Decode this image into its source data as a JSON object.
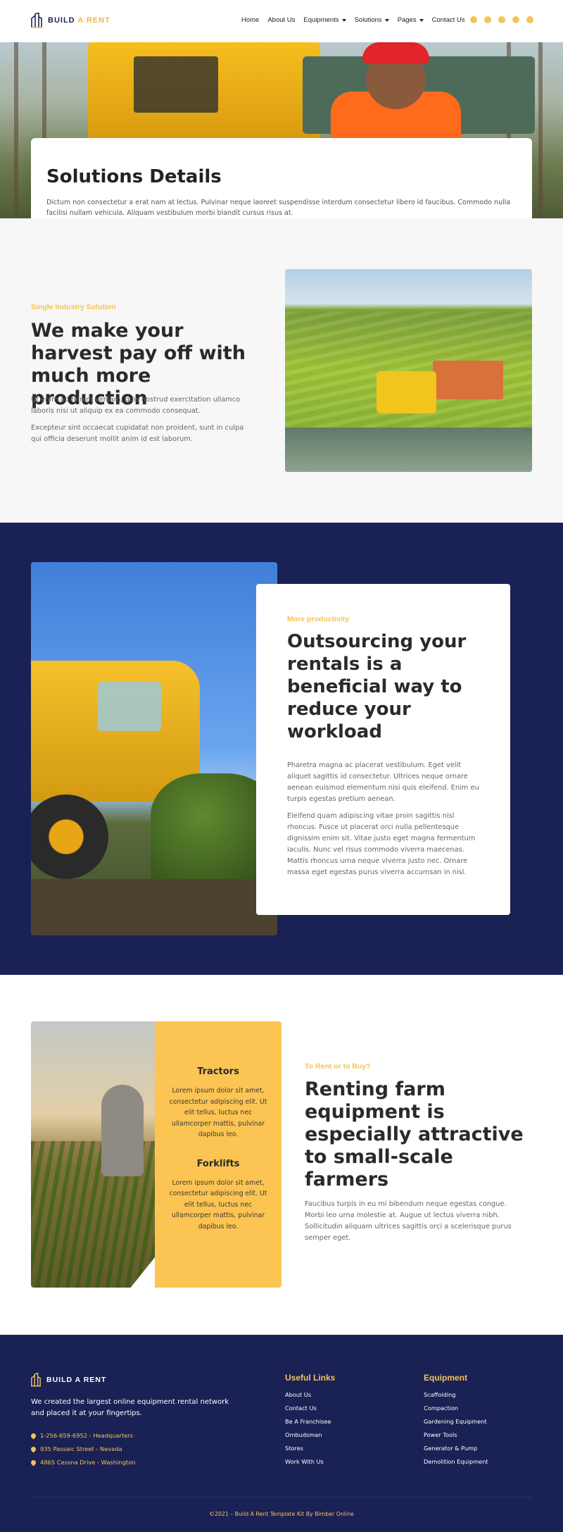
{
  "header": {
    "logo_part1": "BUILD",
    "logo_part2": "A RENT",
    "nav": [
      "Home",
      "About Us",
      "Equipments",
      "Solutions",
      "Pages",
      "Contact Us"
    ],
    "social_icons": [
      "instagram-icon",
      "facebook-icon",
      "twitter-icon",
      "youtube-icon",
      "dribbble-icon"
    ]
  },
  "hero": {
    "title": "Solutions Details",
    "text": "Dictum non consectetur a erat nam at lectus. Pulvinar neque laoreet suspendisse interdum consectetur libero id faucibus. Commodo nulla facilisi nullam vehicula. Aliquam vestibulum morbi blandit cursus risus at."
  },
  "section1": {
    "eyebrow": "Single Industry Solution",
    "heading": "We make your harvest pay off with much more production",
    "p1": "Ut enim ad minim veniam, quis nostrud exercitation ullamco laboris nisi ut aliquip ex ea commodo consequat.",
    "p2": "Excepteur sint occaecat cupidatat non proident, sunt in culpa qui officia deserunt mollit anim id est laborum."
  },
  "section2": {
    "eyebrow": "More productivity",
    "heading": "Outsourcing your rentals is a beneficial way to reduce your workload",
    "p1": "Pharetra magna ac placerat vestibulum. Eget velit aliquet sagittis id consectetur. Ultrices neque ornare aenean euismod elementum nisi quis eleifend. Enim eu turpis egestas pretium aenean.",
    "p2": "Eleifend quam adipiscing vitae proin sagittis nisl rhoncus. Fusce ut placerat orci nulla pellentesque dignissim enim sit. Vitae justo eget magna fermentum iaculis. Nunc vel risus commodo viverra maecenas. Mattis rhoncus urna neque viverra justo nec. Ornare massa eget egestas purus viverra accumsan in nisl."
  },
  "section3": {
    "card_title1": "Tractors",
    "card_text1": "Lorem ipsum dolor sit amet, consectetur adipiscing elit. Ut elit tellus, luctus nec ullamcorper mattis, pulvinar dapibus leo.",
    "card_title2": "Forklifts",
    "card_text2": "Lorem ipsum dolor sit amet, consectetur adipiscing elit. Ut elit tellus, luctus nec ullamcorper mattis, pulvinar dapibus leo.",
    "eyebrow": "To Rent or to Buy?",
    "heading": "Renting farm equipment is especially attractive to small-scale farmers",
    "p1": "Faucibus turpis in eu mi bibendum neque egestas congue. Morbi leo urna molestie at. Augue ut lectus viverra nibh. Sollicitudin aliquam ultrices sagittis orci a scelerisque purus semper eget."
  },
  "footer": {
    "logo": "BUILD A RENT",
    "description": "We created the largest online equipment rental network and placed it at your fingertips.",
    "contacts": [
      "1-256-659-6952 - Headquarters",
      "935 Passaic Street - Nevada",
      "4865 Cessna Drive - Washington"
    ],
    "useful_links_title": "Useful Links",
    "useful_links": [
      "About Us",
      "Contact Us",
      "Be A Franchisee",
      "Ombudsman",
      "Stores",
      "Work With Us"
    ],
    "equipment_title": "Equipment",
    "equipment": [
      "Scaffolding",
      "Compaction",
      "Gardening Equipment",
      "Power Tools",
      "Generator & Pump",
      "Demolition Equipment"
    ],
    "copyright": "©2021 – Build A Rent Template Kit By Bimber Online"
  },
  "colors": {
    "accent": "#f4c35b",
    "navy": "#1a2154",
    "yellow_card": "#fcc452"
  }
}
